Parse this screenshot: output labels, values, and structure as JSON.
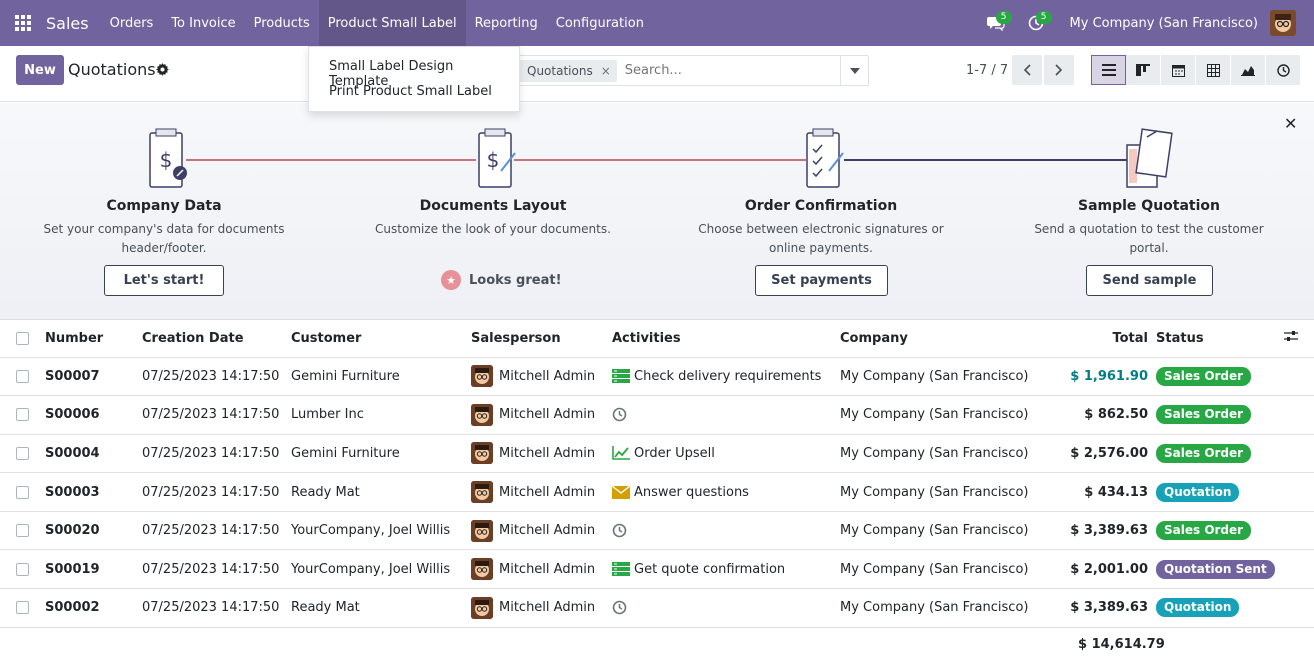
{
  "navbar": {
    "app_name": "Sales",
    "menu": [
      "Orders",
      "To Invoice",
      "Products",
      "Product Small Label",
      "Reporting",
      "Configuration"
    ],
    "messages_count": "5",
    "activities_count": "5",
    "company": "My Company (San Francisco)"
  },
  "dropdown": {
    "items": [
      "Small Label Design Template",
      "Print Product Small Label"
    ]
  },
  "control_panel": {
    "new_label": "New",
    "title": "Quotations",
    "facet_label": "Quotations",
    "search_placeholder": "Search...",
    "pager": "1-7 / 7"
  },
  "banner": {
    "steps": [
      {
        "title": "Company Data",
        "desc": "Set your company's data for documents header/footer.",
        "button": "Let's start!"
      },
      {
        "title": "Documents Layout",
        "desc": "Customize the look of your documents.",
        "done": "Looks great!"
      },
      {
        "title": "Order Confirmation",
        "desc": "Choose between electronic signatures or online payments.",
        "button": "Set payments"
      },
      {
        "title": "Sample Quotation",
        "desc": "Send a quotation to test the customer portal.",
        "button": "Send sample"
      }
    ]
  },
  "table": {
    "headers": {
      "number": "Number",
      "date": "Creation Date",
      "customer": "Customer",
      "salesperson": "Salesperson",
      "activities": "Activities",
      "company": "Company",
      "total": "Total",
      "status": "Status"
    },
    "rows": [
      {
        "number": "S00007",
        "date": "07/25/2023 14:17:50",
        "customer": "Gemini Furniture",
        "salesperson": "Mitchell Admin",
        "activity": "Check delivery requirements",
        "activity_icon": "list-icon",
        "company": "My Company (San Francisco)",
        "total": "$ 1,961.90",
        "status": "Sales Order"
      },
      {
        "number": "S00006",
        "date": "07/25/2023 14:17:50",
        "customer": "Lumber Inc",
        "salesperson": "Mitchell Admin",
        "activity": "",
        "activity_icon": "clock-icon",
        "company": "My Company (San Francisco)",
        "total": "$ 862.50",
        "status": "Sales Order"
      },
      {
        "number": "S00004",
        "date": "07/25/2023 14:17:50",
        "customer": "Gemini Furniture",
        "salesperson": "Mitchell Admin",
        "activity": "Order Upsell",
        "activity_icon": "chart-icon",
        "company": "My Company (San Francisco)",
        "total": "$ 2,576.00",
        "status": "Sales Order"
      },
      {
        "number": "S00003",
        "date": "07/25/2023 14:17:50",
        "customer": "Ready Mat",
        "salesperson": "Mitchell Admin",
        "activity": "Answer questions",
        "activity_icon": "envelope-icon",
        "company": "My Company (San Francisco)",
        "total": "$ 434.13",
        "status": "Quotation"
      },
      {
        "number": "S00020",
        "date": "07/25/2023 14:17:50",
        "customer": "YourCompany, Joel Willis",
        "salesperson": "Mitchell Admin",
        "activity": "",
        "activity_icon": "clock-icon",
        "company": "My Company (San Francisco)",
        "total": "$ 3,389.63",
        "status": "Sales Order"
      },
      {
        "number": "S00019",
        "date": "07/25/2023 14:17:50",
        "customer": "YourCompany, Joel Willis",
        "salesperson": "Mitchell Admin",
        "activity": "Get quote confirmation",
        "activity_icon": "list-icon",
        "company": "My Company (San Francisco)",
        "total": "$ 2,001.00",
        "status": "Quotation Sent"
      },
      {
        "number": "S00002",
        "date": "07/25/2023 14:17:50",
        "customer": "Ready Mat",
        "salesperson": "Mitchell Admin",
        "activity": "",
        "activity_icon": "clock-icon",
        "company": "My Company (San Francisco)",
        "total": "$ 3,389.63",
        "status": "Quotation"
      }
    ],
    "sum_total": "$ 14,614.79"
  },
  "colors": {
    "brand": "#71639e",
    "sales_order": "#28a745",
    "quotation": "#17a2b8",
    "quotation_sent": "#71639e",
    "link": "#017e84"
  }
}
